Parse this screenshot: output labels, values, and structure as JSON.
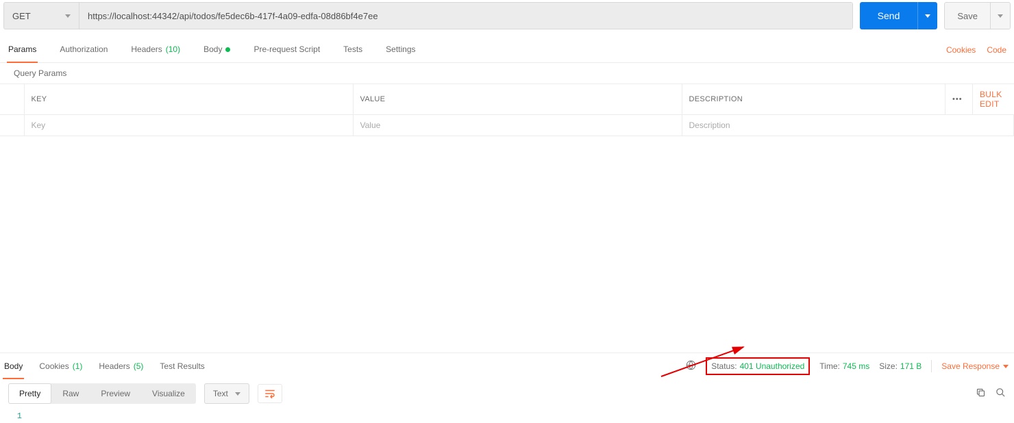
{
  "request": {
    "method": "GET",
    "url": "https://localhost:44342/api/todos/fe5dec6b-417f-4a09-edfa-08d86bf4e7ee",
    "send_label": "Send",
    "save_label": "Save"
  },
  "request_tabs": {
    "params": "Params",
    "authorization": "Authorization",
    "headers": "Headers",
    "headers_count": "(10)",
    "body": "Body",
    "prerequest": "Pre-request Script",
    "tests": "Tests",
    "settings": "Settings",
    "cookies_link": "Cookies",
    "code_link": "Code"
  },
  "query_params": {
    "section_label": "Query Params",
    "header_key": "KEY",
    "header_value": "VALUE",
    "header_desc": "DESCRIPTION",
    "bulk_edit": "Bulk Edit",
    "placeholder_key": "Key",
    "placeholder_value": "Value",
    "placeholder_desc": "Description"
  },
  "response_tabs": {
    "body": "Body",
    "cookies": "Cookies",
    "cookies_count": "(1)",
    "headers": "Headers",
    "headers_count": "(5)",
    "test_results": "Test Results"
  },
  "response_meta": {
    "status_label": "Status:",
    "status_value": "401 Unauthorized",
    "time_label": "Time:",
    "time_value": "745 ms",
    "size_label": "Size:",
    "size_value": "171 B",
    "save_response": "Save Response"
  },
  "body_view": {
    "pretty": "Pretty",
    "raw": "Raw",
    "preview": "Preview",
    "visualize": "Visualize",
    "lang": "Text",
    "line_1": "1"
  }
}
